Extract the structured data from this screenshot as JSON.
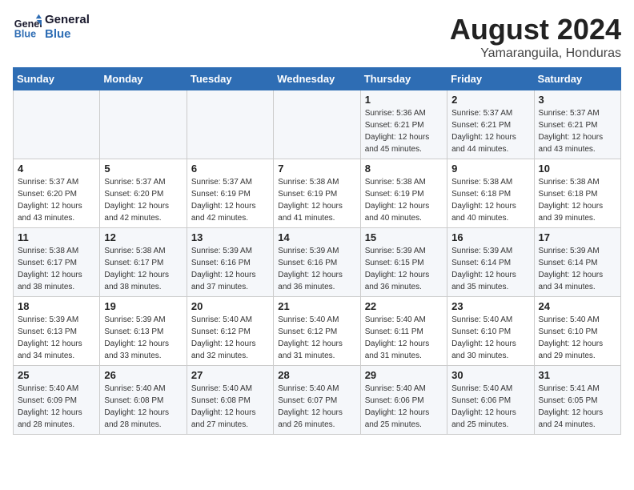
{
  "logo": {
    "line1": "General",
    "line2": "Blue"
  },
  "title": "August 2024",
  "subtitle": "Yamaranguila, Honduras",
  "days_header": [
    "Sunday",
    "Monday",
    "Tuesday",
    "Wednesday",
    "Thursday",
    "Friday",
    "Saturday"
  ],
  "weeks": [
    [
      {
        "day": "",
        "info": ""
      },
      {
        "day": "",
        "info": ""
      },
      {
        "day": "",
        "info": ""
      },
      {
        "day": "",
        "info": ""
      },
      {
        "day": "1",
        "info": "Sunrise: 5:36 AM\nSunset: 6:21 PM\nDaylight: 12 hours\nand 45 minutes."
      },
      {
        "day": "2",
        "info": "Sunrise: 5:37 AM\nSunset: 6:21 PM\nDaylight: 12 hours\nand 44 minutes."
      },
      {
        "day": "3",
        "info": "Sunrise: 5:37 AM\nSunset: 6:21 PM\nDaylight: 12 hours\nand 43 minutes."
      }
    ],
    [
      {
        "day": "4",
        "info": "Sunrise: 5:37 AM\nSunset: 6:20 PM\nDaylight: 12 hours\nand 43 minutes."
      },
      {
        "day": "5",
        "info": "Sunrise: 5:37 AM\nSunset: 6:20 PM\nDaylight: 12 hours\nand 42 minutes."
      },
      {
        "day": "6",
        "info": "Sunrise: 5:37 AM\nSunset: 6:19 PM\nDaylight: 12 hours\nand 42 minutes."
      },
      {
        "day": "7",
        "info": "Sunrise: 5:38 AM\nSunset: 6:19 PM\nDaylight: 12 hours\nand 41 minutes."
      },
      {
        "day": "8",
        "info": "Sunrise: 5:38 AM\nSunset: 6:19 PM\nDaylight: 12 hours\nand 40 minutes."
      },
      {
        "day": "9",
        "info": "Sunrise: 5:38 AM\nSunset: 6:18 PM\nDaylight: 12 hours\nand 40 minutes."
      },
      {
        "day": "10",
        "info": "Sunrise: 5:38 AM\nSunset: 6:18 PM\nDaylight: 12 hours\nand 39 minutes."
      }
    ],
    [
      {
        "day": "11",
        "info": "Sunrise: 5:38 AM\nSunset: 6:17 PM\nDaylight: 12 hours\nand 38 minutes."
      },
      {
        "day": "12",
        "info": "Sunrise: 5:38 AM\nSunset: 6:17 PM\nDaylight: 12 hours\nand 38 minutes."
      },
      {
        "day": "13",
        "info": "Sunrise: 5:39 AM\nSunset: 6:16 PM\nDaylight: 12 hours\nand 37 minutes."
      },
      {
        "day": "14",
        "info": "Sunrise: 5:39 AM\nSunset: 6:16 PM\nDaylight: 12 hours\nand 36 minutes."
      },
      {
        "day": "15",
        "info": "Sunrise: 5:39 AM\nSunset: 6:15 PM\nDaylight: 12 hours\nand 36 minutes."
      },
      {
        "day": "16",
        "info": "Sunrise: 5:39 AM\nSunset: 6:14 PM\nDaylight: 12 hours\nand 35 minutes."
      },
      {
        "day": "17",
        "info": "Sunrise: 5:39 AM\nSunset: 6:14 PM\nDaylight: 12 hours\nand 34 minutes."
      }
    ],
    [
      {
        "day": "18",
        "info": "Sunrise: 5:39 AM\nSunset: 6:13 PM\nDaylight: 12 hours\nand 34 minutes."
      },
      {
        "day": "19",
        "info": "Sunrise: 5:39 AM\nSunset: 6:13 PM\nDaylight: 12 hours\nand 33 minutes."
      },
      {
        "day": "20",
        "info": "Sunrise: 5:40 AM\nSunset: 6:12 PM\nDaylight: 12 hours\nand 32 minutes."
      },
      {
        "day": "21",
        "info": "Sunrise: 5:40 AM\nSunset: 6:12 PM\nDaylight: 12 hours\nand 31 minutes."
      },
      {
        "day": "22",
        "info": "Sunrise: 5:40 AM\nSunset: 6:11 PM\nDaylight: 12 hours\nand 31 minutes."
      },
      {
        "day": "23",
        "info": "Sunrise: 5:40 AM\nSunset: 6:10 PM\nDaylight: 12 hours\nand 30 minutes."
      },
      {
        "day": "24",
        "info": "Sunrise: 5:40 AM\nSunset: 6:10 PM\nDaylight: 12 hours\nand 29 minutes."
      }
    ],
    [
      {
        "day": "25",
        "info": "Sunrise: 5:40 AM\nSunset: 6:09 PM\nDaylight: 12 hours\nand 28 minutes."
      },
      {
        "day": "26",
        "info": "Sunrise: 5:40 AM\nSunset: 6:08 PM\nDaylight: 12 hours\nand 28 minutes."
      },
      {
        "day": "27",
        "info": "Sunrise: 5:40 AM\nSunset: 6:08 PM\nDaylight: 12 hours\nand 27 minutes."
      },
      {
        "day": "28",
        "info": "Sunrise: 5:40 AM\nSunset: 6:07 PM\nDaylight: 12 hours\nand 26 minutes."
      },
      {
        "day": "29",
        "info": "Sunrise: 5:40 AM\nSunset: 6:06 PM\nDaylight: 12 hours\nand 25 minutes."
      },
      {
        "day": "30",
        "info": "Sunrise: 5:40 AM\nSunset: 6:06 PM\nDaylight: 12 hours\nand 25 minutes."
      },
      {
        "day": "31",
        "info": "Sunrise: 5:41 AM\nSunset: 6:05 PM\nDaylight: 12 hours\nand 24 minutes."
      }
    ]
  ]
}
